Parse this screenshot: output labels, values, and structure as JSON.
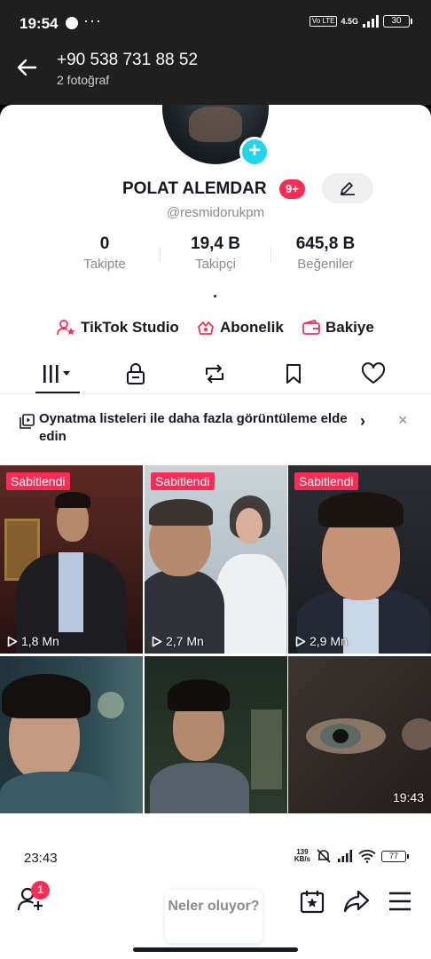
{
  "status_bar": {
    "time": "19:54",
    "more": "···",
    "volte": "Vo LTE",
    "network": "4.5G",
    "battery": "30"
  },
  "header": {
    "title": "+90 538 731 88 52",
    "subtitle": "2 fotoğraf"
  },
  "profile": {
    "name": "POLAT ALEMDAR",
    "badge": "9+",
    "username": "@resmidorukpm",
    "stats": [
      {
        "value": "0",
        "label": "Takipte"
      },
      {
        "value": "19,4 B",
        "label": "Takipçi"
      },
      {
        "value": "645,8 B",
        "label": "Beğeniler"
      }
    ],
    "bio": "."
  },
  "quick_links": [
    {
      "label": "TikTok Studio",
      "icon": "user-star-icon"
    },
    {
      "label": "Abonelik",
      "icon": "subscription-icon"
    },
    {
      "label": "Bakiye",
      "icon": "wallet-icon"
    }
  ],
  "tabs": [
    {
      "name": "videos",
      "icon": "grid-bars-icon",
      "active": true
    },
    {
      "name": "private",
      "icon": "lock-icon"
    },
    {
      "name": "reposts",
      "icon": "repost-icon"
    },
    {
      "name": "saved",
      "icon": "bookmark-icon"
    },
    {
      "name": "liked",
      "icon": "heart-icon"
    }
  ],
  "playlist_banner": {
    "text": "Oynatma listeleri ile daha fazla görüntüleme elde edin",
    "chevron": "›",
    "close": "×"
  },
  "videos": [
    {
      "pinned": "Sabitlendi",
      "views": "1,8 Mn"
    },
    {
      "pinned": "Sabitlendi",
      "views": "2,7 Mn"
    },
    {
      "pinned": "Sabitlendi",
      "views": "2,9 Mn"
    },
    {
      "views": ""
    },
    {
      "views": ""
    },
    {
      "duration": "19:43"
    }
  ],
  "bottom_bar": {
    "time": "23:43",
    "speed_value": "139",
    "speed_unit": "KB/s",
    "battery": "77",
    "notification_count": "1",
    "compose_placeholder": "Neler oluyor?"
  },
  "colors": {
    "accent": "#fe2c55",
    "plus": "#20d5ec",
    "text": "#161823",
    "muted": "#8a8b91"
  }
}
